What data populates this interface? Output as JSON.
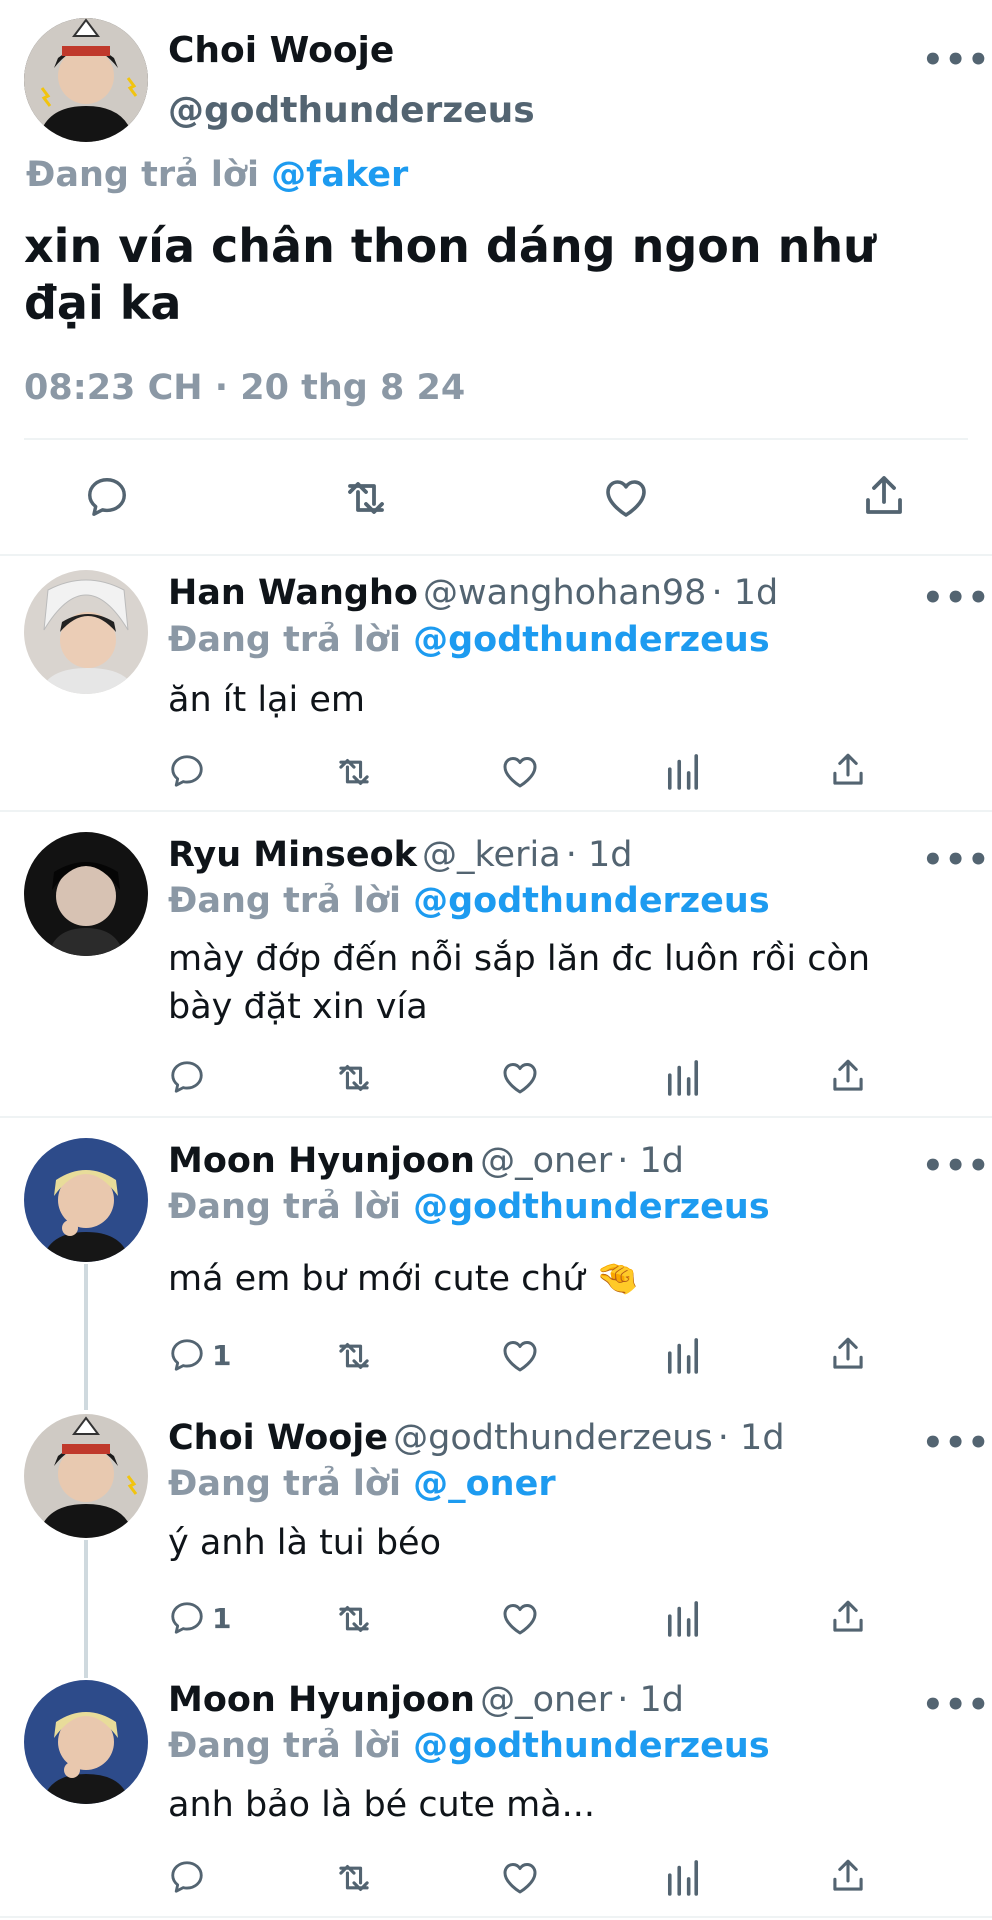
{
  "main_tweet": {
    "name": "Choi Wooje",
    "handle": "@godthunderzeus",
    "replying_label": "Đang trả lời",
    "replying_to": "@faker",
    "text": "xin vía chân thon dáng ngon như đại ka",
    "timestamp": "08:23 CH · 20 thg 8 24",
    "more": "•••"
  },
  "replies": [
    {
      "name": "Han Wangho",
      "handle": "@wanghohan98",
      "time": "· 1d",
      "replying_label": "Đang trả lời",
      "replying_to": "@godthunderzeus",
      "text": "ăn ít lại em",
      "reply_count": "",
      "more": "•••"
    },
    {
      "name": "Ryu Minseok",
      "handle": "@_keria",
      "time": "· 1d",
      "replying_label": "Đang trả lời",
      "replying_to": "@godthunderzeus",
      "text": "mày đớp đến nỗi sắp lăn đc luôn rồi còn bày đặt xin vía",
      "reply_count": "",
      "more": "•••"
    },
    {
      "name": "Moon Hyunjoon",
      "handle": "@_oner",
      "time": "· 1d",
      "replying_label": "Đang trả lời",
      "replying_to": "@godthunderzeus",
      "text": "má em bư mới cute chứ 🤏",
      "reply_count": "1",
      "more": "•••"
    },
    {
      "name": "Choi Wooje",
      "handle": "@godthunderzeus",
      "time": "· 1d",
      "replying_label": "Đang trả lời",
      "replying_to": "@_oner",
      "text": "ý anh là tui béo",
      "reply_count": "1",
      "more": "•••"
    },
    {
      "name": "Moon Hyunjoon",
      "handle": "@_oner",
      "time": "· 1d",
      "replying_label": "Đang trả lời",
      "replying_to": "@godthunderzeus",
      "text": "anh bảo là bé cute mà...",
      "reply_count": "",
      "more": "•••"
    }
  ],
  "icons": [
    "comment-icon",
    "retweet-icon",
    "like-icon",
    "views-icon",
    "share-icon",
    "more-icon"
  ],
  "colors": {
    "accent": "#1d9bf0",
    "muted": "#536471",
    "reply_gray": "#8b98a5",
    "text": "#0f1419",
    "divider": "#eff3f4"
  }
}
